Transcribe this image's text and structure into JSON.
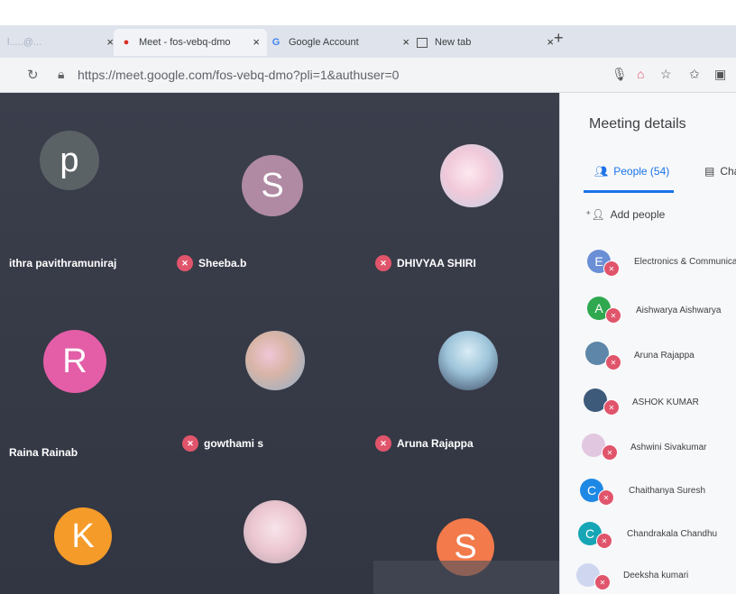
{
  "browser": {
    "tabs": [
      {
        "label": "l.....@...",
        "favicon": "gmail-icon"
      },
      {
        "label": "Meet - fos-vebq-dmo",
        "favicon": "meet-icon"
      },
      {
        "label": "Google Account",
        "favicon": "google-g-icon"
      },
      {
        "label": "New tab",
        "favicon": "newtab-icon"
      }
    ],
    "url": "https://meet.google.com/fos-vebq-dmo?pli=1&authuser=0"
  },
  "grid": {
    "tiles": [
      {
        "initial": "p",
        "name": "ithra pavithramuniraj",
        "color": "#5b6266",
        "muted": false
      },
      {
        "initial": "S",
        "name": "Sheeba.b",
        "color": "#b08aa2",
        "muted": true
      },
      {
        "initial": "",
        "name": "DHIVYAA SHIRI",
        "color": "#f1d8e6",
        "muted": true
      },
      {
        "initial": "R",
        "name": "Raina Rainab",
        "color": "#e35ea7",
        "muted": false
      },
      {
        "initial": "",
        "name": "gowthami s",
        "color": "#c4d7e6",
        "muted": true
      },
      {
        "initial": "",
        "name": "Aruna Rajappa",
        "color": "#7ba7c5",
        "muted": true
      },
      {
        "initial": "K",
        "name": "",
        "color": "#f59b2a",
        "muted": false
      },
      {
        "initial": "",
        "name": "",
        "color": "#f1dbe4",
        "muted": false
      },
      {
        "initial": "S",
        "name": "",
        "color": "#f27a4b",
        "muted": false
      }
    ]
  },
  "panel": {
    "title": "Meeting details",
    "tab_people": "People (54)",
    "tab_chat": "Cha",
    "add_people": "Add people",
    "people": [
      {
        "initial": "E",
        "name": "Electronics & Communication E",
        "color": "#6b8fd6"
      },
      {
        "initial": "A",
        "name": "Aishwarya Aishwarya",
        "color": "#2fa84f"
      },
      {
        "initial": "",
        "name": "Aruna Rajappa",
        "color": "#5d86a8"
      },
      {
        "initial": "",
        "name": "ASHOK KUMAR",
        "color": "#3d5a7a"
      },
      {
        "initial": "",
        "name": "Ashwini Sivakumar",
        "color": "#e2c7e0"
      },
      {
        "initial": "C",
        "name": "Chaithanya Suresh",
        "color": "#1e88e5"
      },
      {
        "initial": "C",
        "name": "Chandrakala Chandhu",
        "color": "#16a6b6"
      },
      {
        "initial": "",
        "name": "Deeksha kumari",
        "color": "#cfd6f0"
      }
    ]
  }
}
